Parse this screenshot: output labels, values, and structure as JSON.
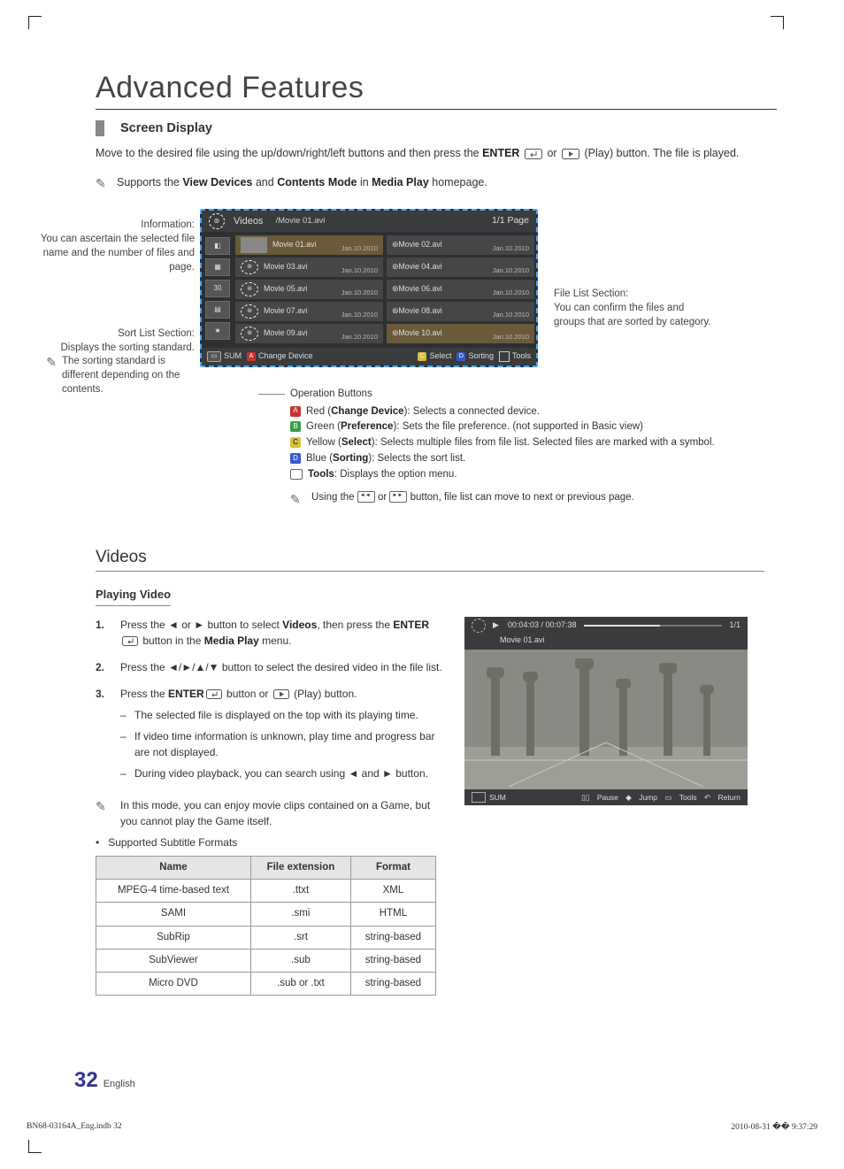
{
  "page": {
    "section_title": "Advanced Features",
    "sub_heading": "Screen Display",
    "intro": "Move to the desired file using the up/down/right/left buttons and then press the ",
    "intro_enter": "ENTER",
    "intro_mid": " or ",
    "intro_play_suffix": " (Play) button. The file is played.",
    "note1_pre": "Supports the ",
    "note1_b1": "View Devices",
    "note1_mid": " and ",
    "note1_b2": "Contents Mode",
    "note1_mid2": " in ",
    "note1_b3": "Media Play",
    "note1_end": " homepage."
  },
  "labels": {
    "info_title": "Information:",
    "info_body": "You can ascertain the selected file name and the number of files and page.",
    "sort_title": "Sort List Section:",
    "sort_body": "Displays the sorting standard.",
    "sort_note": "The sorting standard is different depending on the contents.",
    "right_title": "File List Section:",
    "right_body": "You can confirm the files and groups that are sorted by category."
  },
  "panel": {
    "title": "Videos",
    "path": "/Movie 01.avi",
    "page": "1/1 Page",
    "footer_sum": "SUM",
    "footer_change": "Change Device",
    "footer_select": "Select",
    "footer_sorting": "Sorting",
    "footer_tools": "Tools",
    "files": [
      {
        "l": "Movie 01.avi",
        "r": "Movie 02.avi",
        "d": "Jan.10.2010"
      },
      {
        "l": "Movie 03.avi",
        "r": "Movie 04.avi",
        "d": "Jan.10.2010"
      },
      {
        "l": "Movie 05.avi",
        "r": "Movie 06.avi",
        "d": "Jan.10.2010"
      },
      {
        "l": "Movie 07.avi",
        "r": "Movie 08.avi",
        "d": "Jan.10.2010"
      },
      {
        "l": "Movie 09.avi",
        "r": "Movie 10.avi",
        "d": "Jan.10.2010"
      }
    ]
  },
  "ops": {
    "title": "Operation Buttons",
    "a_pre": "Red (",
    "a_b": "Change Device",
    "a_post": "): Selects a connected device.",
    "b_pre": "Green (",
    "b_b": "Preference",
    "b_post": "): Sets the file preference. (not supported in Basic view)",
    "c_pre": "Yellow (",
    "c_b": "Select",
    "c_post": "): Selects multiple files from file list. Selected files are marked with a symbol.",
    "d_pre": "Blue (",
    "d_b": "Sorting",
    "d_post": "): Selects the sort list.",
    "t_b": "Tools",
    "t_post": ": Displays the option menu.",
    "note_pre": "Using the ",
    "note_mid": " or ",
    "note_post": " button, file list can move to next or previous page."
  },
  "videos": {
    "heading": "Videos",
    "play_title": "Playing Video",
    "step1_pre": "Press the ◄ or ► button to select ",
    "step1_b": "Videos",
    "step1_mid": ", then press the ",
    "step1_b2": "ENTER",
    "step1_mid2": " button in the ",
    "step1_b3": "Media Play",
    "step1_end": " menu.",
    "step2": "Press the ◄/►/▲/▼ button to select the desired video in the file list.",
    "step3_pre": "Press the ",
    "step3_b": "ENTER",
    "step3_mid": " button or ",
    "step3_end": " (Play) button.",
    "sub1": "The selected file is displayed on the top with its playing time.",
    "sub2": "If video time information is unknown, play time and progress bar are not displayed.",
    "sub3": "During video playback, you can search using ◄ and ► button.",
    "note": "In this mode, you can enjoy movie clips contained on a Game, but you cannot play the Game itself.",
    "bullet": "Supported Subtitle Formats"
  },
  "table": {
    "h1": "Name",
    "h2": "File extension",
    "h3": "Format",
    "rows": [
      {
        "c1": "MPEG-4 time-based text",
        "c2": ".ttxt",
        "c3": "XML"
      },
      {
        "c1": "SAMI",
        "c2": ".smi",
        "c3": "HTML"
      },
      {
        "c1": "SubRip",
        "c2": ".srt",
        "c3": "string-based"
      },
      {
        "c1": "SubViewer",
        "c2": ".sub",
        "c3": "string-based"
      },
      {
        "c1": "Micro DVD",
        "c2": ".sub or .txt",
        "c3": "string-based"
      }
    ]
  },
  "player": {
    "time": "00:04:03 / 00:07:38",
    "page": "1/1",
    "file": "Movie 01.avi",
    "sum": "SUM",
    "foot": "Pause   Jump   Tools   Return",
    "f1": "Pause",
    "f2": "Jump",
    "f3": "Tools",
    "f4": "Return"
  },
  "footer": {
    "page_num": "32",
    "lang": "English",
    "left": "BN68-03164A_Eng.indb   32",
    "right": "2010-08-31   �� 9:37:29"
  }
}
